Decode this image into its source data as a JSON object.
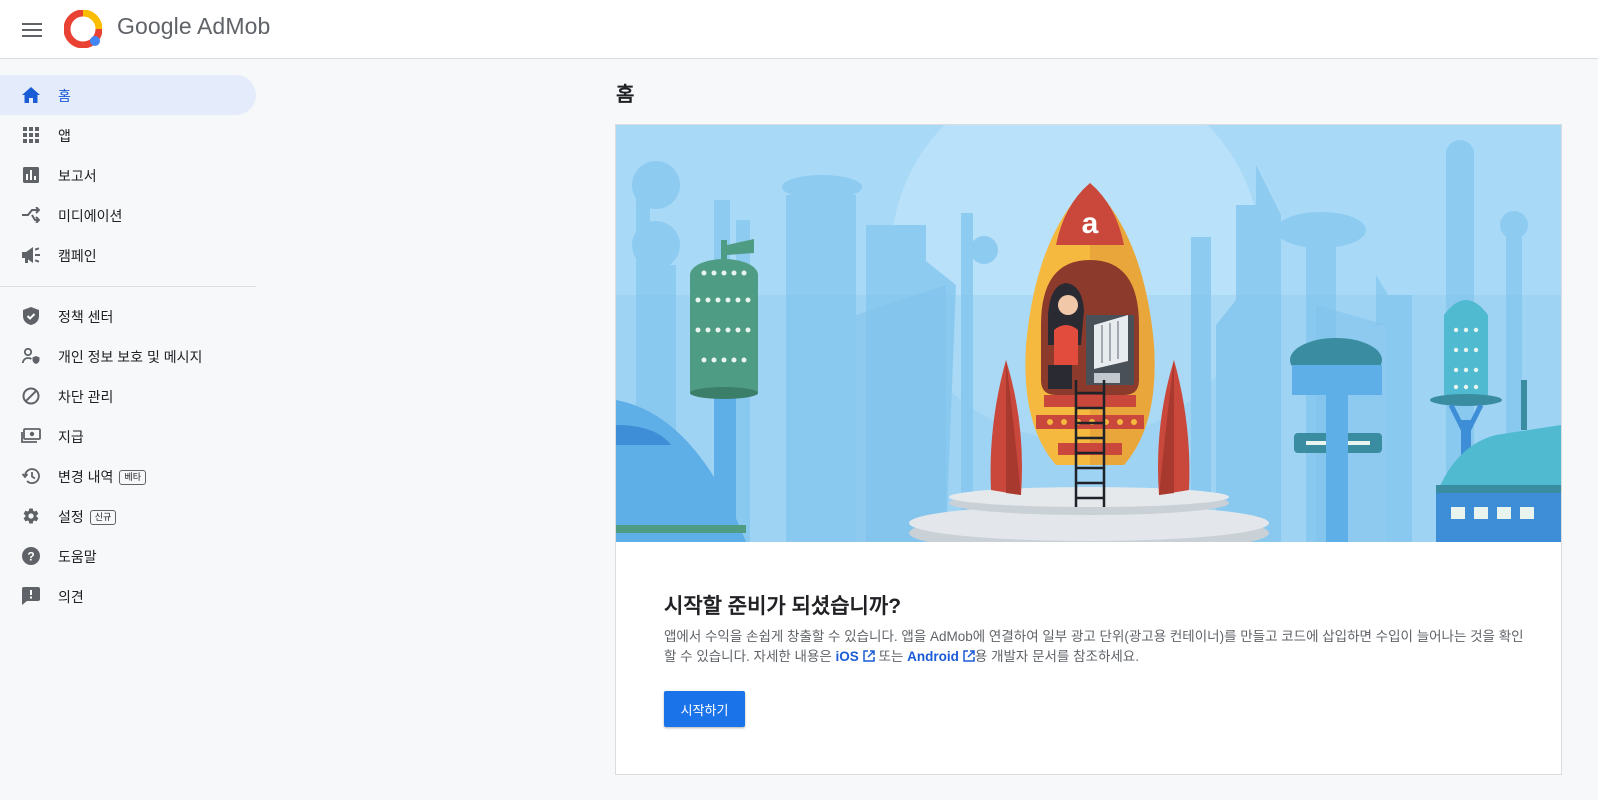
{
  "header": {
    "brand": "Google AdMob"
  },
  "sidebar": {
    "items": [
      {
        "label": "홈",
        "icon": "home-icon",
        "active": true
      },
      {
        "label": "앱",
        "icon": "apps-grid-icon"
      },
      {
        "label": "보고서",
        "icon": "bar-chart-icon"
      },
      {
        "label": "미디에이션",
        "icon": "mediation-icon"
      },
      {
        "label": "캠페인",
        "icon": "megaphone-icon"
      },
      {
        "label": "정책 센터",
        "icon": "shield-check-icon"
      },
      {
        "label": "개인 정보 보호 및 메시지",
        "icon": "privacy-person-icon"
      },
      {
        "label": "차단 관리",
        "icon": "block-icon"
      },
      {
        "label": "지급",
        "icon": "payments-icon"
      },
      {
        "label": "변경 내역",
        "icon": "history-icon",
        "badge": "베타"
      },
      {
        "label": "설정",
        "icon": "gear-icon",
        "badge": "신규"
      },
      {
        "label": "도움말",
        "icon": "help-icon"
      },
      {
        "label": "의견",
        "icon": "feedback-icon"
      }
    ]
  },
  "main": {
    "title": "홈",
    "card": {
      "title": "시작할 준비가 되셨습니까?",
      "desc_part1": "앱에서 수익을 손쉽게 창출할 수 있습니다. 앱을 AdMob에 연결하여 일부 광고 단위(광고용 컨테이너)를 만들고 코드에 삽입하면 수입이 늘어나는 것을 확인할 수 있습니다. 자세한 내용은 ",
      "ios_link": "iOS",
      "desc_part2": " 또는 ",
      "android_link": "Android",
      "desc_part3": "용 개발자 문서를 참조하세요.",
      "button": "시작하기"
    }
  },
  "colors": {
    "accent": "#1a73e8",
    "active_nav_bg": "#e4ecfb",
    "hero_sky": "#9fd3f5"
  }
}
